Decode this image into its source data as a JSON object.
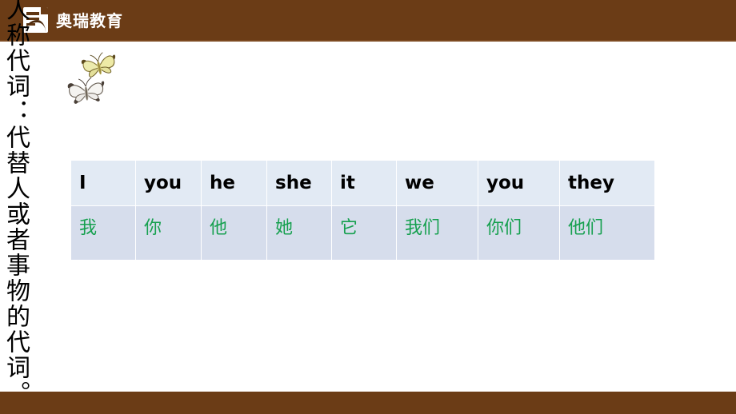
{
  "slide": {
    "background_color": "#ffffff",
    "brand_color": "#6b3c16",
    "accent_green": "#16a04f",
    "table_header_bg": "#e2eaf4",
    "table_body_bg": "#d6ddec"
  },
  "header": {
    "brand_name": "奥瑞教育",
    "logo_icon": "document-book-icon"
  },
  "caption": {
    "vertical_text": "人称代词：代替人或者事物的代词。"
  },
  "decoration": {
    "butterfly_yellow": "butterfly-yellow-icon",
    "butterfly_white": "butterfly-white-icon"
  },
  "table": {
    "english": [
      "I",
      "you",
      "he",
      "she",
      "it",
      "we",
      "you",
      "they"
    ],
    "chinese": [
      "我",
      "你",
      "他",
      "她",
      "它",
      "我们",
      "你们",
      "他们"
    ]
  },
  "footer": {
    "bar_color": "#6b3c16"
  }
}
